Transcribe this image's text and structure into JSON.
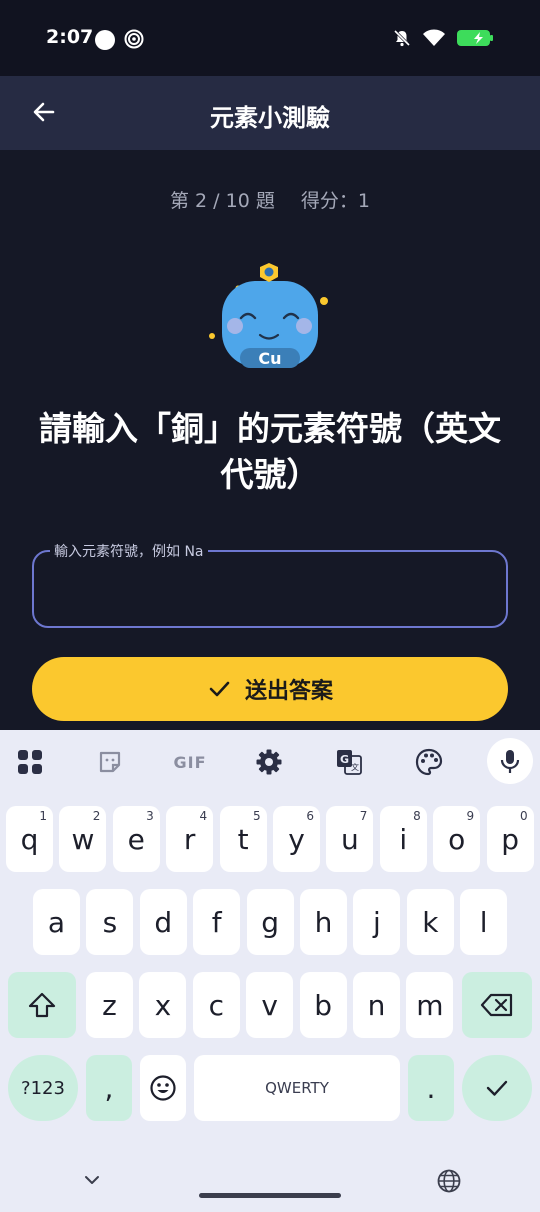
{
  "status": {
    "time": "2:07"
  },
  "app_bar": {
    "title": "元素小測驗"
  },
  "progress": {
    "question": "第 2 / 10 題",
    "score": "得分：1"
  },
  "mascot": {
    "symbol": "Cu"
  },
  "question": {
    "line1": "請輸入「銅」的元素符號（英文",
    "line2": "代號）"
  },
  "answer_field": {
    "label": "輸入元素符號，例如 Na",
    "value": ""
  },
  "submit": {
    "label": "送出答案",
    "icon": "check-icon"
  },
  "keyboard": {
    "toolbar": [
      "apps-grid-icon",
      "sticker-icon",
      "GIF",
      "settings-icon",
      "translate-icon",
      "palette-icon",
      "mic-icon"
    ],
    "gif_label": "GIF",
    "row1": [
      {
        "k": "q",
        "h": "1"
      },
      {
        "k": "w",
        "h": "2"
      },
      {
        "k": "e",
        "h": "3"
      },
      {
        "k": "r",
        "h": "4"
      },
      {
        "k": "t",
        "h": "5"
      },
      {
        "k": "y",
        "h": "6"
      },
      {
        "k": "u",
        "h": "7"
      },
      {
        "k": "i",
        "h": "8"
      },
      {
        "k": "o",
        "h": "9"
      },
      {
        "k": "p",
        "h": "0"
      }
    ],
    "row2": [
      "a",
      "s",
      "d",
      "f",
      "g",
      "h",
      "j",
      "k",
      "l"
    ],
    "row3": [
      "z",
      "x",
      "c",
      "v",
      "b",
      "n",
      "m"
    ],
    "symbols_label": "?123",
    "comma_label": ",",
    "space_label": "QWERTY",
    "period_label": "."
  },
  "colors": {
    "background": "#151826",
    "app_bar": "#262b43",
    "accent": "#fbc82e",
    "field_border": "#6d77cf",
    "mascot": "#4ea6ea"
  }
}
